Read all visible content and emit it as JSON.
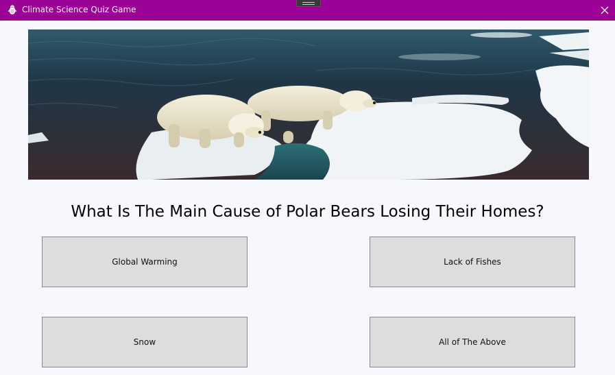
{
  "window": {
    "title": "Climate Science Quiz Game",
    "titlebar_color": "#9b0296",
    "app_icon": "penguin-icon",
    "close_icon": "close-icon"
  },
  "hero_image": {
    "subject": "polar-bears-on-ice-floe"
  },
  "quiz": {
    "question": "What Is The Main Cause of Polar Bears Losing Their Homes?",
    "answers": [
      "Global Warming",
      "Lack of Fishes",
      "Snow",
      "All of The Above"
    ]
  }
}
